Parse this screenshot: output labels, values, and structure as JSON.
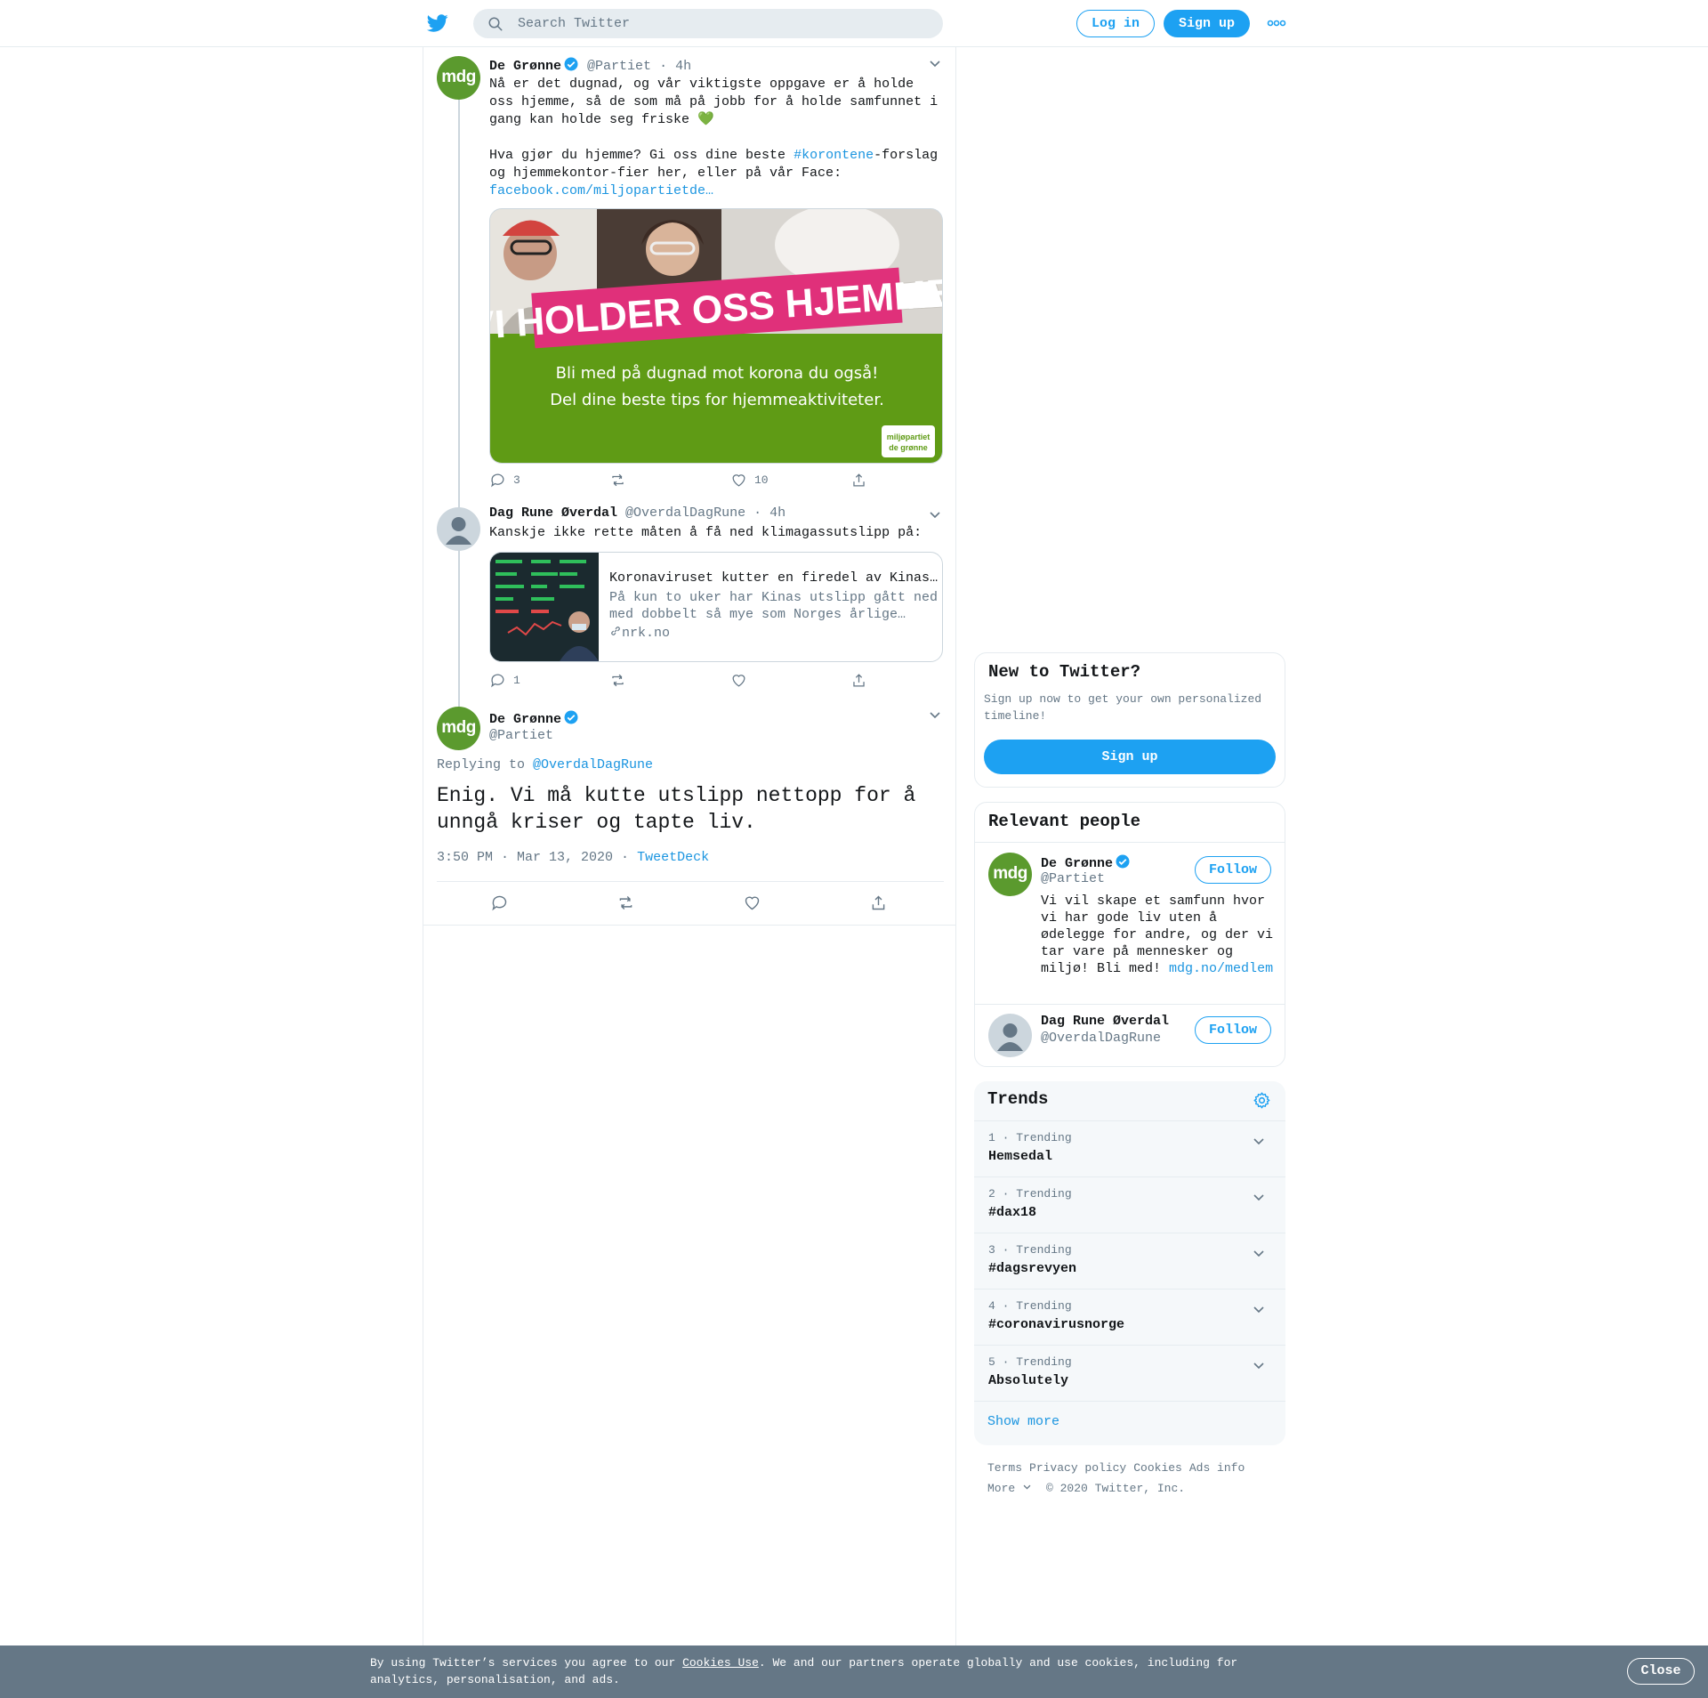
{
  "topbar": {
    "search_placeholder": "Search Twitter",
    "login_label": "Log in",
    "signup_label": "Sign up"
  },
  "tweets": [
    {
      "avatar_text": "mdg",
      "name": "De Grønne",
      "handle": "@Partiet",
      "time": "· 4h",
      "text_1": "Nå er det dugnad, og vår viktigste oppgave er å holde oss hjemme, så de som må på jobb for å holde samfunnet i gang kan holde seg friske 💚",
      "text_2a": "Hva gjør du hjemme? Gi oss dine beste ",
      "hashtag": "#korontene",
      "text_2b": "-forslag og hjemmekontor-fier her, eller på vår Face: ",
      "link": "facebook.com/miljopartietde…",
      "image": {
        "banner": "VI HOLDER OSS HJEMME!",
        "line1": "Bli med på dugnad mot korona du også!",
        "line2": "Del dine beste tips for hjemmeaktiviteter.",
        "logo_l1": "miljøpartiet",
        "logo_l2": "de grønne"
      },
      "replies": "3",
      "retweets": "",
      "likes": "10"
    },
    {
      "name": "Dag Rune Øverdal",
      "handle": "@OverdalDagRune",
      "time": "· 4h",
      "text": "Kanskje ikke rette måten å få ned klimagassutslipp på:",
      "card": {
        "title": "Koronaviruset kutter en firedel av Kinas utslipp",
        "desc": "På kun to uker har Kinas utslipp gått ned med dobbelt så mye som Norges årlige…",
        "domain": "nrk.no"
      },
      "replies": "1",
      "retweets": "",
      "likes": ""
    }
  ],
  "focus_tweet": {
    "avatar_text": "mdg",
    "name": "De Grønne",
    "handle": "@Partiet",
    "replying_prefix": "Replying to ",
    "replying_to": "@OverdalDagRune",
    "text": "Enig. Vi må kutte utslipp nettopp for å unngå kriser og tapte liv.",
    "timestamp": "3:50 PM · Mar 13, 2020 ·",
    "source": "TweetDeck"
  },
  "sidebar": {
    "new_to_twitter": {
      "title": "New to Twitter?",
      "text": "Sign up now to get your own personalized timeline!",
      "button": "Sign up"
    },
    "relevant_people": {
      "title": "Relevant people",
      "people": [
        {
          "avatar_text": "mdg",
          "name": "De Grønne",
          "handle": "@Partiet",
          "bio": "Vi vil skape et samfunn hvor vi har gode liv uten å ødelegge for andre, og der vi tar vare på mennesker og miljø! Bli med!",
          "link": "mdg.no/medlem",
          "follow": "Follow"
        },
        {
          "name": "Dag Rune Øverdal",
          "handle": "@OverdalDagRune",
          "follow": "Follow"
        }
      ]
    },
    "trends": {
      "title": "Trends",
      "items": [
        {
          "meta": "1 · Trending",
          "name": "Hemsedal"
        },
        {
          "meta": "2 · Trending",
          "name": "#dax18"
        },
        {
          "meta": "3 · Trending",
          "name": "#dagsrevyen"
        },
        {
          "meta": "4 · Trending",
          "name": "#coronavirusnorge"
        },
        {
          "meta": "5 · Trending",
          "name": "Absolutely"
        }
      ],
      "show_more": "Show more"
    },
    "footer": {
      "links": [
        "Terms",
        "Privacy policy",
        "Cookies",
        "Ads info"
      ],
      "more": "More",
      "copyright": "© 2020 Twitter, Inc."
    }
  },
  "cookie_bar": {
    "text_before": "By using Twitter’s services you agree to our ",
    "link": "Cookies Use",
    "text_after": ". We and our partners operate globally and use cookies, including for analytics, personalisation, and ads.",
    "close": "Close"
  },
  "colors": {
    "accent": "#1da1f2",
    "link": "#1b95e0",
    "mdg_green": "#5b9a2e",
    "banner_pink": "#e0307a",
    "image_green": "#5f9b15"
  }
}
